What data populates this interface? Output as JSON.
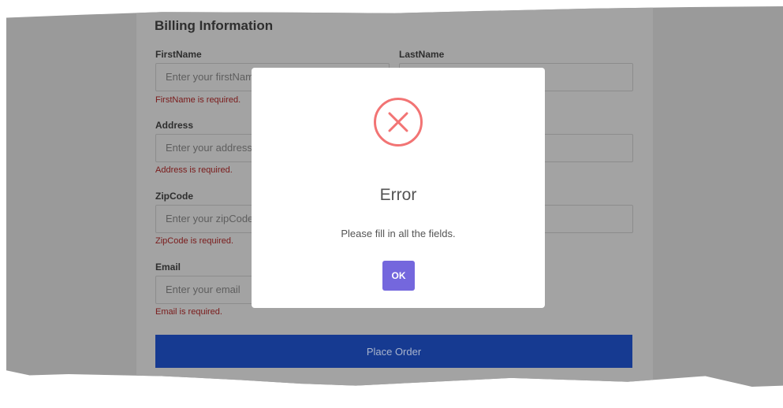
{
  "billing": {
    "title": "Billing Information",
    "first_name": {
      "label": "FirstName",
      "placeholder": "Enter your firstName",
      "error": "FirstName is required."
    },
    "last_name": {
      "label": "LastName",
      "placeholder": ""
    },
    "address": {
      "label": "Address",
      "placeholder": "Enter your address",
      "error": "Address is required."
    },
    "zip": {
      "label": "ZipCode",
      "placeholder": "Enter your zipCode",
      "error": "ZipCode is required."
    },
    "email": {
      "label": "Email",
      "placeholder": "Enter your email",
      "error": "Email is required."
    },
    "submit_label": "Place Order"
  },
  "modal": {
    "icon": "error-x-circle-icon",
    "title": "Error",
    "message": "Please fill in all the fields.",
    "ok_label": "OK"
  },
  "colors": {
    "overlay_gray": "#9a9a9a",
    "error_red": "#f27474",
    "button_purple": "#7467dd",
    "submit_blue": "#163a91"
  }
}
